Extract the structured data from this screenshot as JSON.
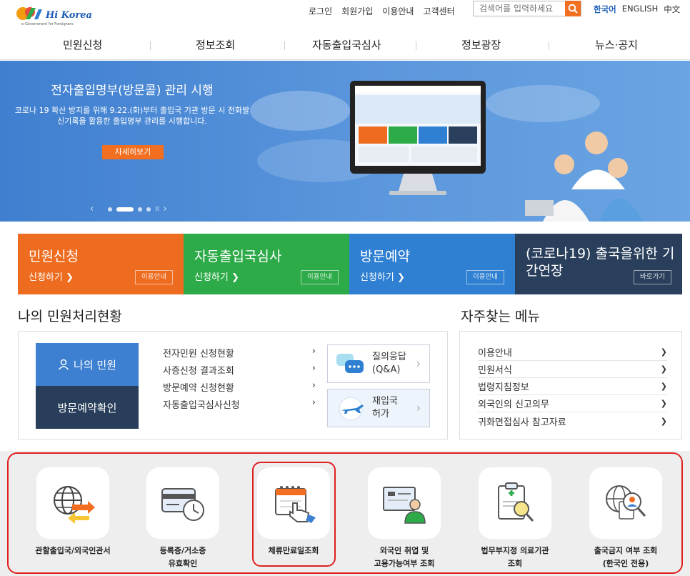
{
  "header": {
    "logo_text": "Hi Korea",
    "logo_sub": "e-Government for Foreigners",
    "utility_links": [
      "로그인",
      "회원가입",
      "이용안내",
      "고객센터"
    ],
    "search_placeholder": "검색어를 입력하세요",
    "languages": [
      "한국어",
      "ENGLISH",
      "中文"
    ]
  },
  "nav": [
    "민원신청",
    "정보조회",
    "자동출입국심사",
    "정보광장",
    "뉴스·공지"
  ],
  "banner": {
    "title": "전자출입명부(방문콜) 관리 시행",
    "text": "코로나 19 확산 방지를 위해 9.22.(화)부터 출입국 기관 방문 시 전화발신기록을 활용한 출입명부 관리를 시행합니다.",
    "button": "자세히보기",
    "prev": "‹",
    "next": "›",
    "pause": "II"
  },
  "tiles": [
    {
      "title": "민원신청",
      "link": "신청하기 ❯",
      "info": "이용안내",
      "color": "#ee6c20"
    },
    {
      "title": "자동출입국심사",
      "link": "신청하기 ❯",
      "info": "이용안내",
      "color": "#2eab49"
    },
    {
      "title": "방문예약",
      "link": "신청하기 ❯",
      "info": "이용안내",
      "color": "#2f7fd2"
    },
    {
      "title": "(코로나19) 출국을위한 기간연장",
      "info": "바로가기",
      "color": "#293f5b"
    }
  ],
  "status": {
    "title": "나의 민원처리현황",
    "my_civil": "나의 민원",
    "visit_check": "방문예약확인",
    "items": [
      "전자민원 신청현황",
      "사증신청 결과조회",
      "방문예약 신청현황",
      "자동출입국심사신청"
    ],
    "chevron": "›",
    "arrow": "❯",
    "qna_label_1": "질의응답",
    "qna_label_2": "(Q&A)",
    "reentry_label_1": "재입국",
    "reentry_label_2": "허가"
  },
  "frequent": {
    "title": "자주찾는 메뉴",
    "items": [
      "이용안내",
      "민원서식",
      "법령지침정보",
      "외국인의 신고의무",
      "귀화면접심사 참고자료"
    ],
    "arrow": "❯"
  },
  "services": [
    {
      "line1": "관할출입국/외국인관서",
      "line2": ""
    },
    {
      "line1": "등록증/거소증",
      "line2": "유효확인"
    },
    {
      "line1": "체류만료일조회",
      "line2": ""
    },
    {
      "line1": "외국인 취업 및",
      "line2": "고용가능여부 조회"
    },
    {
      "line1": "법무부지정 의료기관",
      "line2": "조회"
    },
    {
      "line1": "출국금지 여부 조회",
      "line2": "(한국인 전용)"
    }
  ],
  "colors": {
    "orange": "#ee6c20",
    "green": "#2eab49",
    "blue": "#2f7fd2",
    "navy": "#293f5b",
    "hero": "#5c97dd",
    "highlight": "#e02020"
  },
  "icons": [
    "search-icon",
    "person-icon",
    "chat-icon",
    "plane-icon",
    "globe-arrows-icon",
    "card-clock-icon",
    "calendar-hand-icon",
    "monitor-person-icon",
    "clipboard-magnifier-icon",
    "globe-person-magnifier-icon"
  ]
}
